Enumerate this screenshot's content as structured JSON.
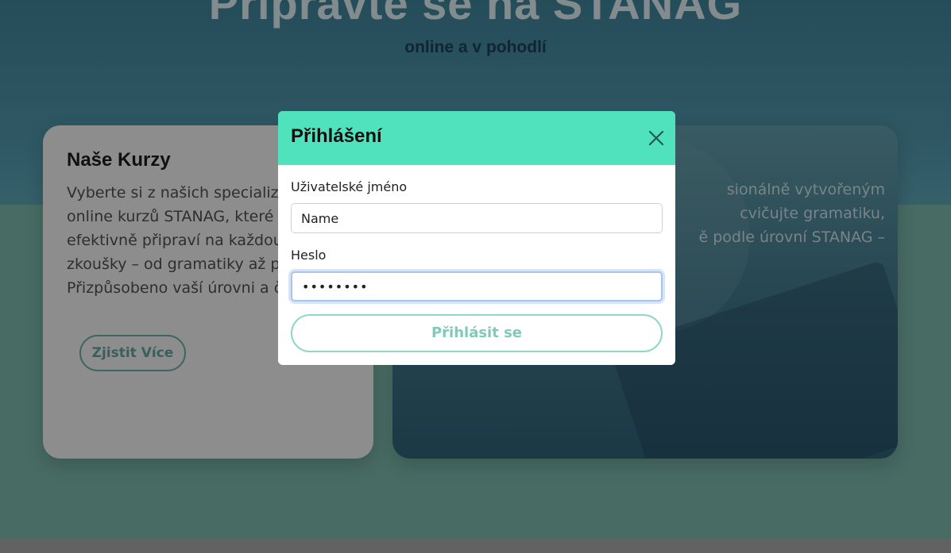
{
  "hero": {
    "title": "Připravte se na STANAG",
    "subtitle": "online a v pohodlí"
  },
  "left_card": {
    "title": "Naše Kurzy",
    "text": "Vyberte si z našich specializovaných online kurzů STANAG, které vás efektivně připraví na každou část zkoušky – od gramatiky až po mluvení. Přizpůsobeno vaší úrovni a času.",
    "button_label": "Zjistit Více"
  },
  "right_card": {
    "text_lines": [
      "sionálně vytvořeným",
      "cvičujte gramatiku,",
      "ě podle úrovní STANAG –"
    ]
  },
  "login_modal": {
    "title": "Přihlášení",
    "close_icon": "close-icon",
    "username_label": "Uživatelské jméno",
    "username_value": "Name",
    "password_label": "Heslo",
    "password_value": "••••••••",
    "submit_label": "Přihlásit se"
  },
  "colors": {
    "modal_header": "#4fe2bd",
    "accent_teal": "#7fcab8",
    "hero_blue": "#3f7f95",
    "band_green": "#78b3a6"
  }
}
